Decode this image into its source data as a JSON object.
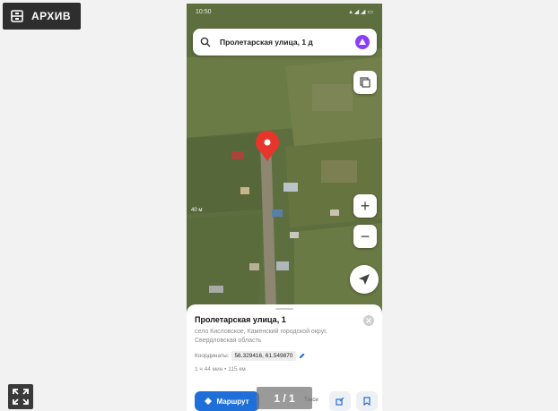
{
  "archive": {
    "label": "АРХИВ",
    "icon": "archive-icon"
  },
  "phone": {
    "status_time": "10:50",
    "search": {
      "query": "Пролетарская улица, 1 д"
    },
    "map": {
      "scale_label": "40 м"
    },
    "card": {
      "title": "Пролетарская улица, 1",
      "address": "село Кисловское, Каменский городской округ, Свердловская область",
      "coords_label": "Координаты:",
      "coords_value": "56.329416, 61.549870",
      "walk": "1 ч 44 мин • 115 км",
      "route_label": "Маршрут",
      "taxi_label": "Такси"
    }
  },
  "gallery": {
    "counter": "1 / 1"
  },
  "colors": {
    "accent": "#1f6fd8",
    "pin": "#e8352b",
    "alice": "#8a3ffc"
  }
}
